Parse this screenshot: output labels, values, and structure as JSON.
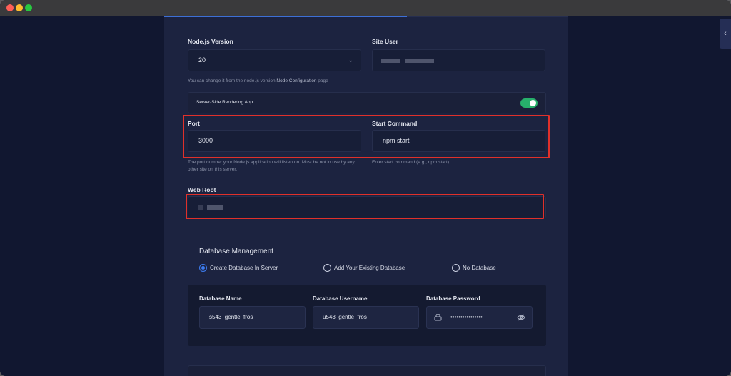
{
  "progress": 0.6,
  "node_version": {
    "label": "Node.js Version",
    "value": "20",
    "hint_prefix": "You can change it from the node.js version ",
    "hint_link": "Node Configuration",
    "hint_suffix": " page"
  },
  "site_user": {
    "label": "Site User"
  },
  "ssr": {
    "label": "Server-Side Rendering App",
    "enabled": true
  },
  "port": {
    "label": "Port",
    "value": "3000",
    "hint": "The port number your Node.js application will listen on. Must be not in use by any other site on this server."
  },
  "start_command": {
    "label": "Start Command",
    "value": "npm start",
    "hint": "Enter start command (e.g., npm start)"
  },
  "web_root": {
    "label": "Web Root"
  },
  "database": {
    "title": "Database Management",
    "options": [
      "Create Database In Server",
      "Add Your Existing Database",
      "No Database"
    ],
    "selected": 0,
    "name_label": "Database Name",
    "name_value": "s543_gentle_fros",
    "username_label": "Database Username",
    "username_value": "u543_gentle_fros",
    "password_label": "Database Password",
    "password_value": "••••••••••••••••"
  },
  "colors": {
    "accent": "#3d6fd6",
    "toggle_on": "#27b06b",
    "highlight": "#e0302a"
  }
}
